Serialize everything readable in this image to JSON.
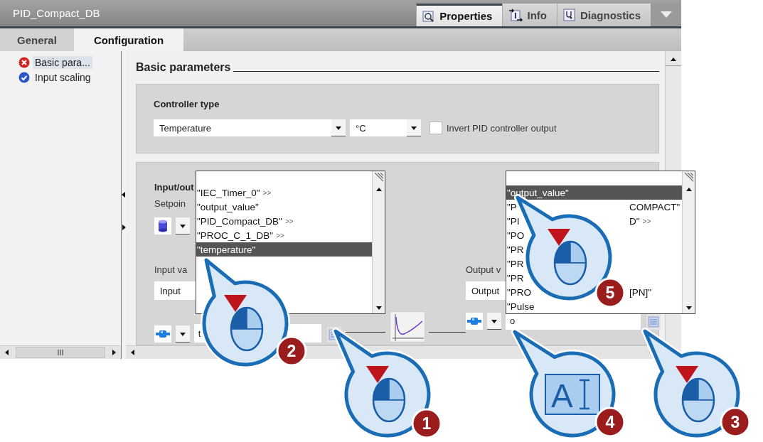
{
  "window": {
    "title": "PID_Compact_DB"
  },
  "view_tabs": [
    {
      "label": "Properties",
      "selected": true
    },
    {
      "label": "Info",
      "selected": false
    },
    {
      "label": "Diagnostics",
      "selected": false
    }
  ],
  "config_tabs": [
    {
      "label": "General",
      "selected": false
    },
    {
      "label": "Configuration",
      "selected": true
    }
  ],
  "nav": {
    "items": [
      {
        "label": "Basic para...",
        "kind": "error",
        "selected": true
      },
      {
        "label": "Input scaling",
        "kind": "ok",
        "selected": false
      }
    ]
  },
  "section_title": "Basic parameters",
  "controller_type": {
    "title": "Controller type",
    "type_value": "Temperature",
    "unit_value": "°C",
    "invert": {
      "label": "Invert PID controller output",
      "checked": false
    }
  },
  "io": {
    "title": "Input/out",
    "setpoint_label": "Setpoin",
    "input_label": "Input va",
    "input_select": "Input",
    "input_field": "t",
    "output_label": "Output v",
    "output_select": "Output",
    "output_field": "o"
  },
  "input_list": {
    "items": [
      {
        "text": "\"IEC_Timer_0\"",
        "suffix": ">>",
        "selected": false
      },
      {
        "text": "\"output_value\"",
        "selected": false
      },
      {
        "text": "\"PID_Compact_DB\"",
        "suffix": ">>",
        "selected": false
      },
      {
        "text": "\"PROC_C_1_DB\"",
        "suffix": ">>",
        "selected": false
      },
      {
        "text": "\"temperature\"",
        "selected": true
      }
    ]
  },
  "output_list": {
    "items": [
      {
        "text": "\"output_value\"",
        "selected": true
      },
      {
        "text": "\"P",
        "tail": "COMPACT\"",
        "selected": false
      },
      {
        "text": "\"PI",
        "tail": "D\"",
        "suffix": ">>",
        "selected": false
      },
      {
        "text": "\"PO",
        "selected": false
      },
      {
        "text": "\"PR",
        "selected": false
      },
      {
        "text": "\"PR",
        "selected": false
      },
      {
        "text": "\"PR",
        "selected": false
      },
      {
        "text": "\"PRO",
        "tail": "[PN]\"",
        "selected": false
      },
      {
        "text": "\"Pulse",
        "selected": false
      }
    ]
  },
  "callouts": [
    {
      "number": "5",
      "kind": "mouse"
    },
    {
      "number": "2",
      "kind": "mouse"
    },
    {
      "number": "1",
      "kind": "mouse"
    },
    {
      "number": "4",
      "kind": "text-input",
      "label": "A"
    },
    {
      "number": "3",
      "kind": "mouse"
    }
  ]
}
